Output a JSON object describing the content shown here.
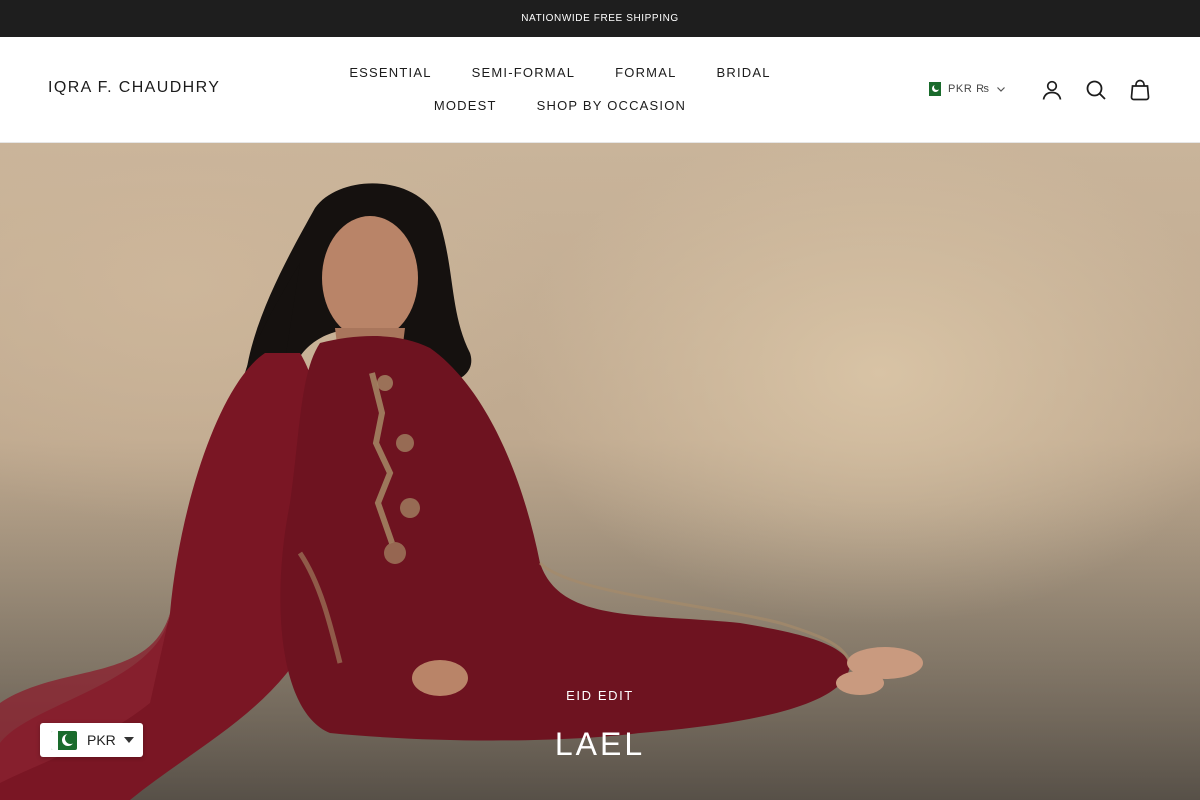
{
  "announcement": {
    "text": "NATIONWIDE FREE SHIPPING"
  },
  "header": {
    "logo": "IQRA F. CHAUDHRY",
    "nav": [
      "ESSENTIAL",
      "SEMI-FORMAL",
      "FORMAL",
      "BRIDAL",
      "MODEST",
      "SHOP BY OCCASION"
    ],
    "currency": "PKR ₨",
    "icons": [
      "account-icon",
      "search-icon",
      "bag-icon"
    ]
  },
  "hero": {
    "eyebrow": "EID EDIT",
    "title": "LAEL"
  },
  "currency_widget": {
    "label": "PKR"
  },
  "colors": {
    "announcement_bg": "#1e1e1e",
    "garment_maroon": "#6e1320",
    "flag_green": "#1a6b2c",
    "backdrop_beige": "#cdb69a"
  }
}
